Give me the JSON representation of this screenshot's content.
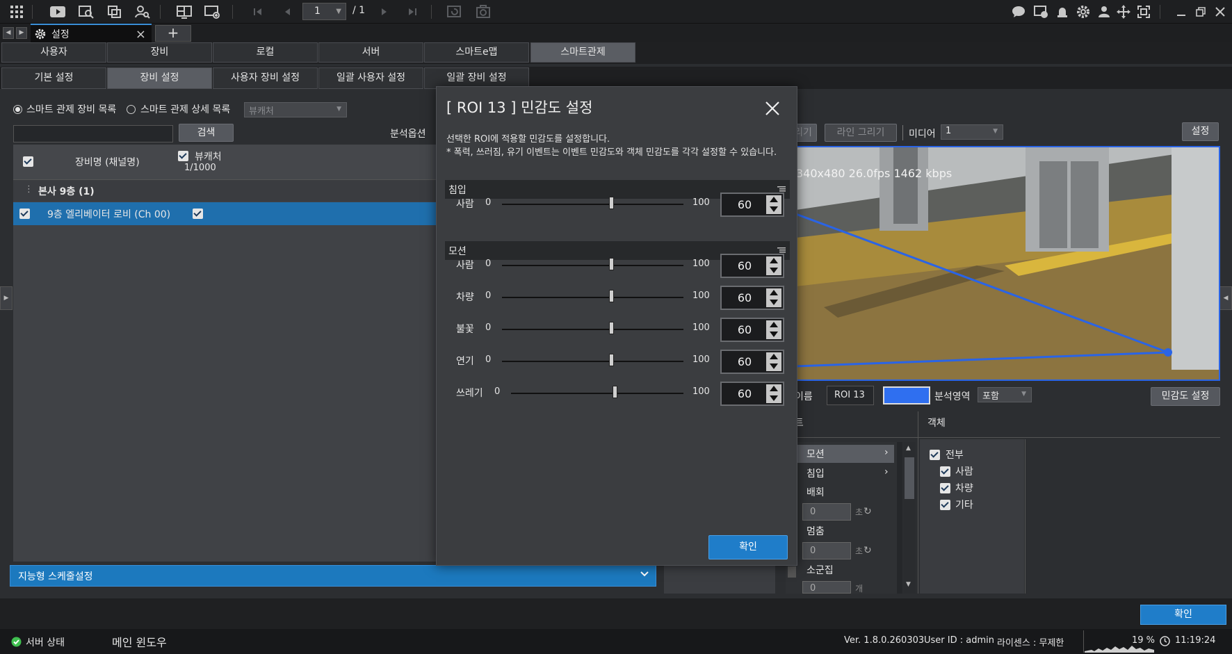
{
  "toolbar": {
    "page_current": "1",
    "page_total": "/ 1"
  },
  "window_tab": {
    "label": "설정"
  },
  "menu_tabs": [
    "사용자",
    "장비",
    "로컬",
    "서버",
    "스마트e맵",
    "스마트관제"
  ],
  "sub_tabs": [
    "기본 설정",
    "장비 설정",
    "사용자 장비 설정",
    "일괄 사용자 설정",
    "일괄 장비 설정"
  ],
  "left": {
    "radio1": "스마트 관제 장비 목록",
    "radio2": "스마트 관제 상세 목록",
    "combo_value": "뷰캐처",
    "search_button": "검색",
    "analysis_option": "분석옵션",
    "col_device": "장비명 (채널명)",
    "col_viewcatcher": "뷰캐처",
    "count": "1/1000",
    "group": "본사 9층 (1)",
    "device_row": "9층 엘리베이터 로비 (Ch 00)",
    "schedule": "지능형 스케줄설정"
  },
  "right": {
    "draw_button_partial": "리기",
    "line_draw": "라인 그리기",
    "media_label": "미디어",
    "media_value": "1",
    "settings_button": "설정",
    "video_info": "340x480  26.0fps 1462 kbps",
    "name_label": "이름",
    "roi_name": "ROI 13",
    "roi_color": "#2f6ff0",
    "area_label": "분석영역",
    "area_value": "포함",
    "sensitivity_button": "민감도 설정",
    "event_header": "벤트",
    "object_header": "객체",
    "events": [
      "모션",
      "침입",
      "배회",
      "멈춤",
      "소군집"
    ],
    "event_values": [
      "0",
      "0",
      "0"
    ],
    "unit_sec": "초",
    "unit_count": "개",
    "objects": [
      "전부",
      "사람",
      "차량",
      "기타"
    ]
  },
  "modal": {
    "title": "[ ROI 13 ] 민감도 설정",
    "desc_line1": "선택한 ROI에 적용할 민감도를 설정합니다.",
    "desc_line2": "* 폭력, 쓰러짐, 유기 이벤트는 이벤트 민감도와 객체 민감도를 각각 설정할 수 있습니다.",
    "section_intrusion": "침입",
    "section_motion": "모션",
    "intrusion_rows": [
      {
        "label": "사람",
        "min": "0",
        "max": "100",
        "value": "60",
        "level": 60
      }
    ],
    "motion_rows": [
      {
        "label": "사람",
        "min": "0",
        "max": "100",
        "value": "60",
        "level": 60
      },
      {
        "label": "차량",
        "min": "0",
        "max": "100",
        "value": "60",
        "level": 60
      },
      {
        "label": "불꽃",
        "min": "0",
        "max": "100",
        "value": "60",
        "level": 60
      },
      {
        "label": "연기",
        "min": "0",
        "max": "100",
        "value": "60",
        "level": 60
      },
      {
        "label": "쓰레기",
        "min": "0",
        "max": "100",
        "value": "60",
        "level": 60
      }
    ],
    "ok_button": "확인"
  },
  "footer": {
    "ok_button": "확인",
    "server_status": "서버 상태",
    "main_window": "메인 윈도우",
    "version": "Ver. 1.8.0.260303",
    "user_id": "User ID : admin",
    "license": "라이센스 : 무제한",
    "cpu": "19 %",
    "clock": "11:19:24"
  }
}
